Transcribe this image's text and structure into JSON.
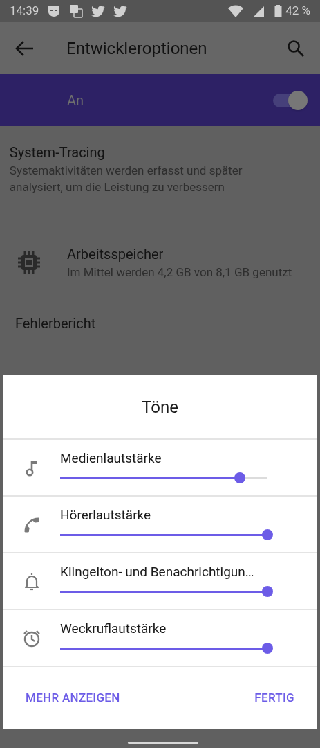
{
  "status_bar": {
    "time": "14:39",
    "battery": "42 %"
  },
  "app_bar": {
    "title": "Entwickleroptionen"
  },
  "master_switch": {
    "label": "An",
    "on": true
  },
  "settings": [
    {
      "title": "System-Tracing",
      "summary": "Systemaktivitäten werden erfasst und später analysiert, um die Leistung zu verbessern"
    },
    {
      "title": "Arbeitsspeicher",
      "summary": "Im Mittel werden 4,2 GB von 8,1 GB genutzt"
    },
    {
      "title": "Fehlerbericht"
    }
  ],
  "dialog": {
    "title": "Töne",
    "sliders": [
      {
        "label": "Medienlautstärke",
        "kind": "music",
        "level": 0.867
      },
      {
        "label": "Hörerlautstärke",
        "kind": "phone",
        "level": 1
      },
      {
        "label": "Klingelton- und Benachrichtigun…",
        "kind": "bell",
        "level": 1
      },
      {
        "label": "Weckruflautstärke",
        "kind": "alarm",
        "level": 1
      }
    ],
    "buttons": [
      "MEHR ANZEIGEN",
      "FERTIG"
    ]
  }
}
